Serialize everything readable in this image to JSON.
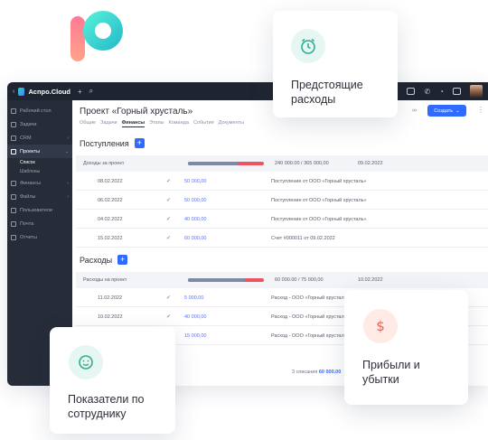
{
  "app": {
    "brand": "Аспро.Cloud",
    "sidebar": {
      "items": [
        "Рабочий стол",
        "Задачи",
        "CRM",
        "Проекты",
        "Финансы",
        "Файлы",
        "Пользователи",
        "Почта",
        "Отчеты"
      ],
      "subitems": [
        "Список",
        "Шаблоны"
      ]
    },
    "page_title": "Проект «Горный хрусталь»",
    "tabs": [
      "Общие",
      "Задачи",
      "Финансы",
      "Этапы",
      "Команда",
      "События",
      "Документы"
    ],
    "create_button": "Создать"
  },
  "income": {
    "title": "Поступления",
    "group": {
      "title": "Доходы за проект",
      "progress": 0.66,
      "sum": "240 000.00 / 365 000,00",
      "date": "09.02.2022"
    },
    "rows": [
      {
        "date": "08.02.2022",
        "amount": "50 000,00",
        "desc": "Поступление от ООО «Горный хрусталь»"
      },
      {
        "date": "06.02.2022",
        "amount": "50 000,00",
        "desc": "Поступление от ООО «Горный хрусталь»"
      },
      {
        "date": "04.02.2022",
        "amount": "40 000,00",
        "desc": "Поступление от ООО «Горный хрусталь»"
      },
      {
        "date": "15.02.2022",
        "amount": "60 000,00",
        "desc": "Счет #000011 от 09.02.2022"
      }
    ]
  },
  "expenses": {
    "title": "Расходы",
    "group": {
      "title": "Расходы на проект",
      "progress": 0.75,
      "sum": "60 000.00 / 75 000,00",
      "date": "10.02.2022"
    },
    "rows": [
      {
        "date": "11.02.2022",
        "amount": "5 000,00",
        "desc": "Расход - ООО «Горный хрусталь»"
      },
      {
        "date": "10.02.2022",
        "amount": "40 000,00",
        "desc": "Расход - ООО «Горный хрусталь»"
      },
      {
        "date": "",
        "amount": "15 000,00",
        "desc": "Расход - ООО «Горный хрусталь»"
      }
    ],
    "total_count": "3",
    "total_label": "списания",
    "total_sum": "60 000.00"
  },
  "cards": {
    "upcoming": "Предстоящие расходы",
    "employees": "Показатели по сотруднику",
    "profit": "Прибыли и убытки"
  },
  "colors": {
    "accent": "#2f6bff",
    "red": "#f0535e",
    "sidebar": "#262c38"
  }
}
